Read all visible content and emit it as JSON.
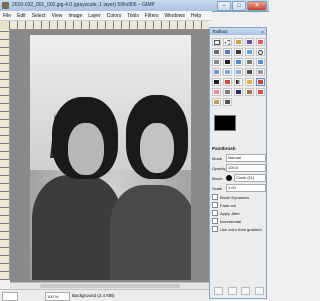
{
  "window": {
    "title": "2010-032_001_002.jpg-4.0 (grayscale, 1 layer) 596x905 – GIMP",
    "minimize": "–",
    "maximize": "□",
    "close": "✕"
  },
  "menubar": {
    "items": [
      "File",
      "Edit",
      "Select",
      "View",
      "Image",
      "Layer",
      "Colors",
      "Tools",
      "Filters",
      "Windows",
      "Help"
    ]
  },
  "statusbar": {
    "zoom": "100 %",
    "text": "Background (2.4 MB)"
  },
  "toolbox": {
    "title": "Toolbox",
    "close": "x",
    "tools": [
      "rect-select-icon",
      "ellipse-select-icon",
      "free-select-icon",
      "fuzzy-select-icon",
      "color-select-icon",
      "scissors-icon",
      "foreground-select-icon",
      "paths-icon",
      "color-picker-icon",
      "zoom-icon",
      "measure-icon",
      "move-icon",
      "align-icon",
      "crop-icon",
      "rotate-icon",
      "scale-icon",
      "shear-icon",
      "perspective-icon",
      "flip-icon",
      "cage-icon",
      "text-icon",
      "bucket-fill-icon",
      "blend-icon",
      "pencil-icon",
      "paintbrush-icon",
      "eraser-icon",
      "airbrush-icon",
      "ink-icon",
      "clone-icon",
      "heal-icon",
      "smudge-icon",
      "dodge-burn-icon"
    ],
    "foreground_color": "#000000",
    "background_color": "#ffffff",
    "options": {
      "tool_name": "Paintbrush",
      "mode_label": "Mode",
      "mode_value": "Normal",
      "opacity_label": "Opacity",
      "opacity_value": "100.0",
      "brush_label": "Brush",
      "brush_value": "Circle (11)",
      "scale_label": "Scale",
      "scale_value": "1.00",
      "brush_dynamics": "Brush Dynamics",
      "fade_out": "Fade out",
      "apply_jitter": "Apply Jitter",
      "incremental": "Incremental",
      "use_color_gradient": "Use color from gradient"
    }
  }
}
